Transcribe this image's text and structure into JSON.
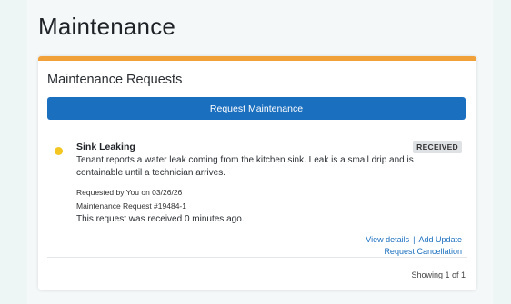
{
  "page": {
    "title": "Maintenance"
  },
  "card": {
    "title": "Maintenance Requests",
    "request_button_label": "Request Maintenance",
    "accent_color": "#f0a13a"
  },
  "requests": [
    {
      "title": "Sink Leaking",
      "status": "RECEIVED",
      "status_color": "#f3c622",
      "description": "Tenant reports a water leak coming from the kitchen sink. Leak is a small drip and is containable until a technician arrives.",
      "requested_by": "Requested by You on 03/26/26",
      "request_number": "Maintenance Request #19484-1",
      "received_text": "This request was received 0 minutes ago.",
      "actions": {
        "view_details": "View details",
        "separator": "|",
        "add_update": "Add Update",
        "cancel": "Request Cancellation"
      }
    }
  ],
  "footer": {
    "showing": "Showing 1 of 1"
  }
}
